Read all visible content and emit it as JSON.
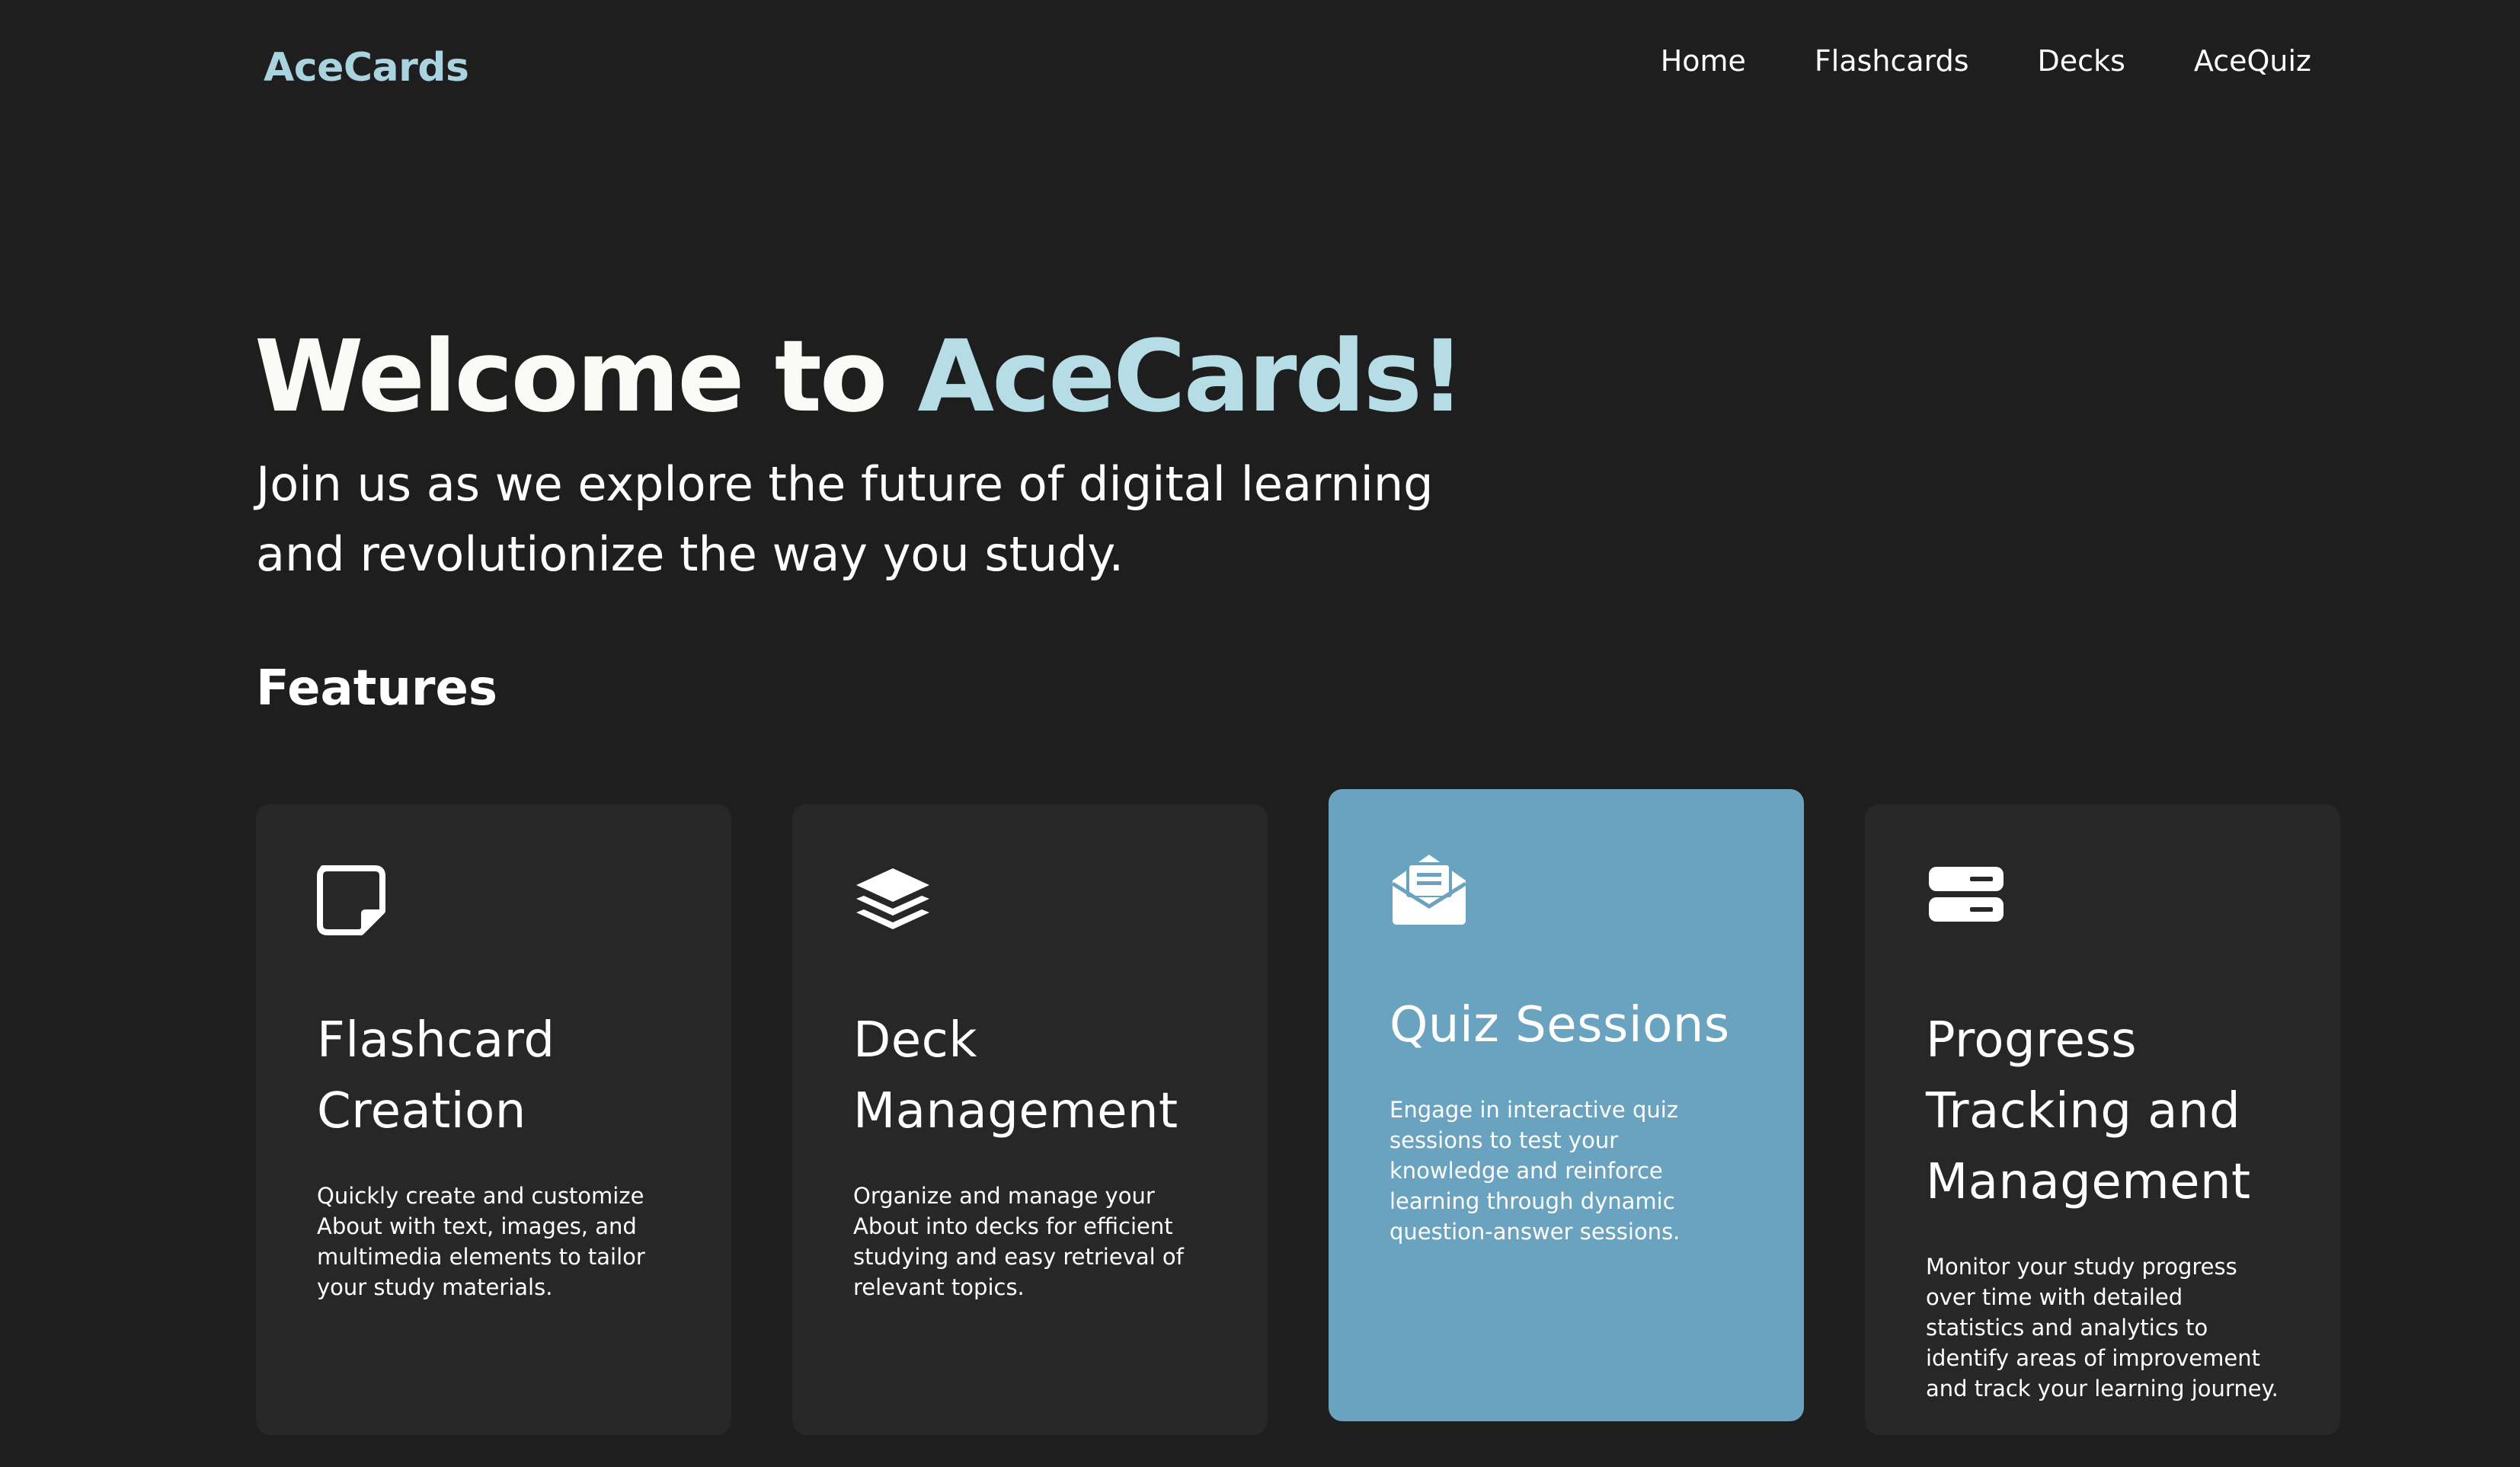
{
  "brand": {
    "name": "AceCards",
    "accent_color": "#a9d3df"
  },
  "nav": {
    "items": [
      {
        "label": "Home"
      },
      {
        "label": "Flashcards"
      },
      {
        "label": "Decks"
      },
      {
        "label": "AceQuiz"
      }
    ]
  },
  "hero": {
    "title_prefix": "Welcome to ",
    "title_accent": "AceCards!",
    "subtitle": "Join us as we explore the future of digital learning and revolutionize the way you study."
  },
  "features": {
    "heading": "Features",
    "cards": [
      {
        "icon": "sticky-note-icon",
        "title": "Flashcard Creation",
        "description": "Quickly create and customize About with text, images, and multimedia elements to tailor your study materials."
      },
      {
        "icon": "layers-icon",
        "title": "Deck Management",
        "description": "Organize and manage your About into decks for efficient studying and easy retrieval of relevant topics."
      },
      {
        "icon": "envelope-open-text-icon",
        "title": "Quiz Sessions",
        "description": "Engage in interactive quiz sessions to test your knowledge and reinforce learning through dynamic question-answer sessions.",
        "highlighted": true
      },
      {
        "icon": "server-icon",
        "title": "Progress Tracking and Management",
        "description": "Monitor your study progress over time with detailed statistics and analytics to identify areas of improvement and track your learning journey."
      }
    ]
  },
  "colors": {
    "background": "#1e1e1f",
    "card": "#272728",
    "card_active": "#6aa3bf",
    "hero_accent": "#b6dde6"
  }
}
